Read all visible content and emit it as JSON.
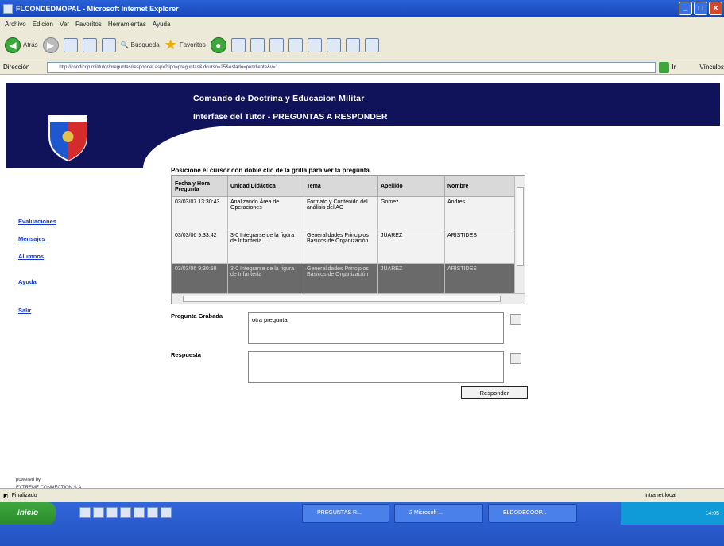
{
  "window": {
    "title": "FLCONDEDMOPAL - Microsoft Internet Explorer"
  },
  "menu": [
    "Archivo",
    "Edición",
    "Ver",
    "Favoritos",
    "Herramientas",
    "Ayuda"
  ],
  "toolbar": {
    "back": "Atrás",
    "search": "Búsqueda",
    "favorites": "Favoritos"
  },
  "address": {
    "label": "Dirección",
    "url": "http://condicop.mil/tutor/preguntas/responder.aspx?tipo=preguntas&idcurso=25&estado=pendiente&v=1",
    "go": "Ir",
    "links": "Vínculos"
  },
  "header": {
    "title": "Comando de Doctrina y Educacion Militar",
    "subtitle": "Interfase del Tutor - PREGUNTAS A RESPONDER"
  },
  "nav": [
    "Evaluaciones",
    "Mensajes",
    "Alumnos",
    "Ayuda",
    "Salir"
  ],
  "footer_left": {
    "line1": "powered by",
    "line2": "EXTREME CONNECTION S.A."
  },
  "intro": "Posicione el cursor con doble clic de la grilla para ver la pregunta.",
  "grid": {
    "headers": [
      "Fecha y Hora Pregunta",
      "Unidad Didáctica",
      "Tema",
      "Apellido",
      "Nombre"
    ],
    "rows": [
      [
        "03/03/07 13:30:43",
        "Analizando Área de Operaciones",
        "Formato y Contenido del análisis del AO",
        "Gomez",
        "Andres"
      ],
      [
        "03/03/06 9:33:42",
        "3-0 Integrarse de la figura de Infantería",
        "Generalidades Principios Básicos de Organización",
        "JUAREZ",
        "ARISTIDES"
      ],
      [
        "03/03/06 9:30:58",
        "3-0 Integrarse de la figura de Infantería",
        "Generalidades Principios Básicos de Organización",
        "JUAREZ",
        "ARISTIDES"
      ]
    ]
  },
  "form": {
    "question_label": "Pregunta Grabada",
    "question_value": "otra pregunta",
    "answer_label": "Respuesta",
    "answer_value": "",
    "submit": "Responder"
  },
  "status": {
    "left": "Finalizado",
    "zone": "Intranet local"
  },
  "taskbar": {
    "start": "inicio",
    "tasks": [
      "PREGUNTAS R...",
      "2 Microsoft ...",
      "ELDODECOOP..."
    ],
    "clock": "14:05"
  },
  "colors": {
    "header_navy": "#10135a",
    "selected_row": "#6a6a6a",
    "link": "#1838c8",
    "taskbar": "#2452c2"
  }
}
